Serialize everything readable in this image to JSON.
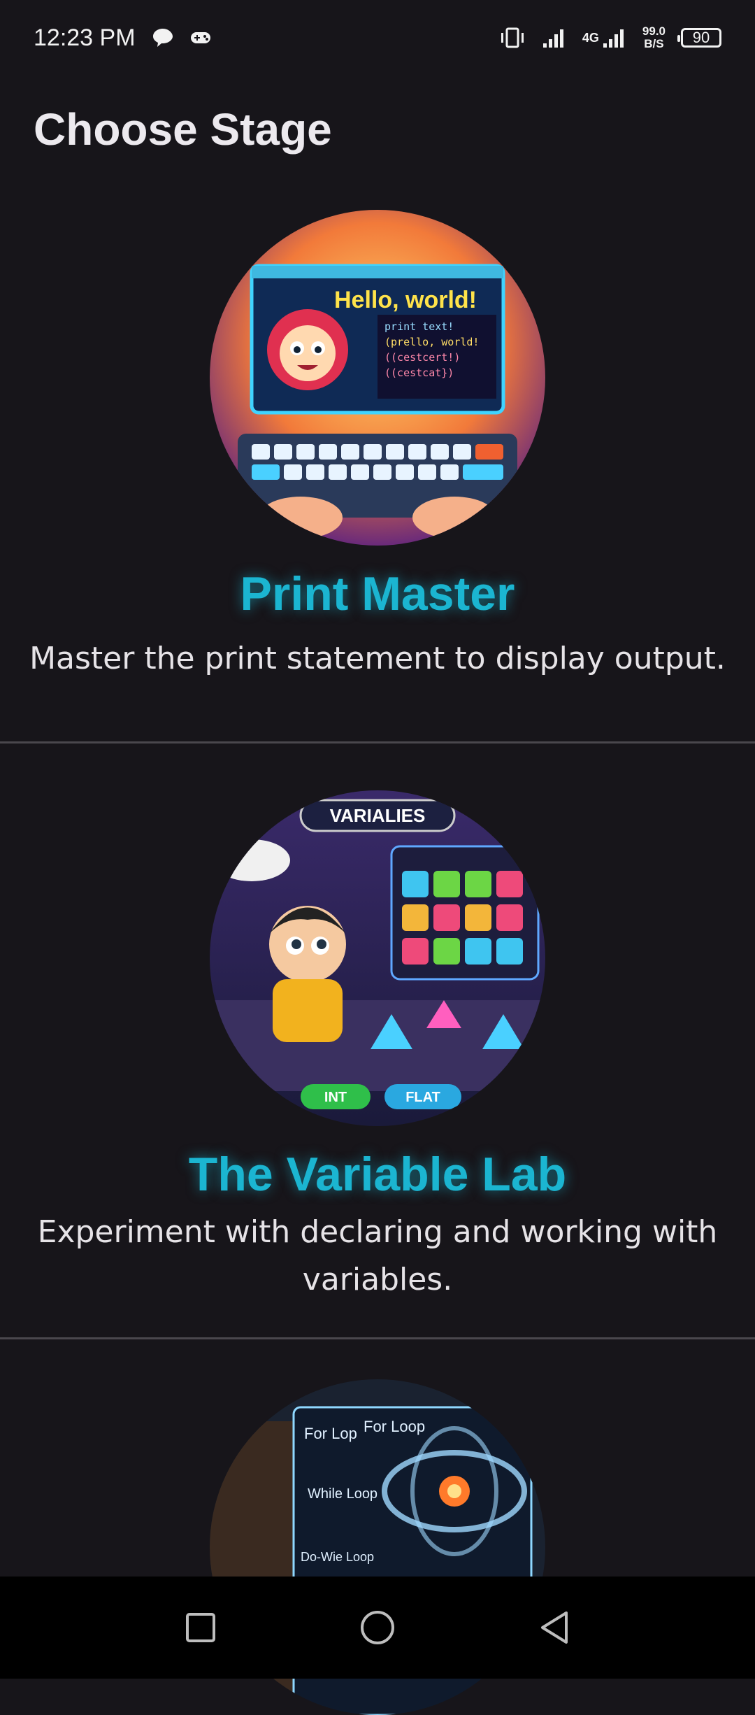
{
  "status_bar": {
    "time": "12:23 PM",
    "left_icons": [
      "chat-bubble-icon",
      "gamepad-icon"
    ],
    "right_icons": [
      "vibrate-icon",
      "signal-icon",
      "signal-4g-icon"
    ],
    "network_type": "4G",
    "net_speed_value": "99.0",
    "net_speed_unit": "B/S",
    "battery": "90"
  },
  "page": {
    "title": "Choose Stage"
  },
  "stages": [
    {
      "title": "Print Master",
      "description": "Master the print statement to display output.",
      "image_caption": "Hello, world!"
    },
    {
      "title": "The Variable Lab",
      "description": "Experiment with declaring and working with variables.",
      "image_caption": "VARIALIES"
    },
    {
      "title": "",
      "description": "",
      "image_caption": "For Loop"
    }
  ],
  "nav_bar": {
    "buttons": [
      "recent-apps-icon",
      "home-icon",
      "back-icon"
    ]
  },
  "colors": {
    "background": "#17151a",
    "accent": "#1bb5d1",
    "divider": "#4a474d"
  }
}
